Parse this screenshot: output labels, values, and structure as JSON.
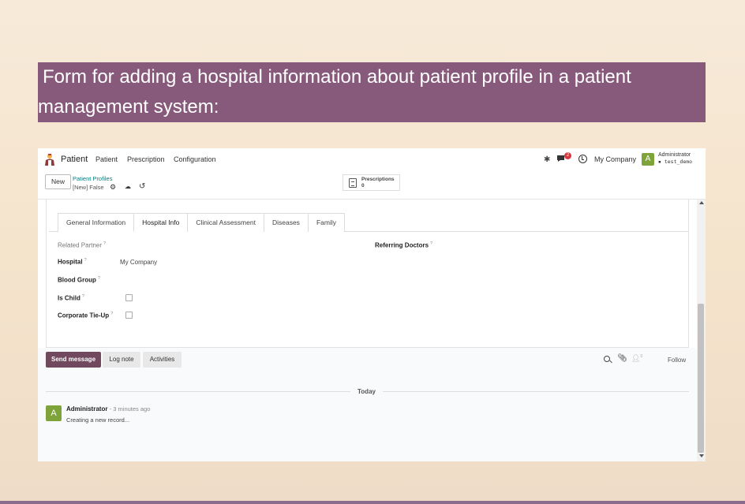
{
  "caption": {
    "line1": "Form for adding a hospital information about patient profile in a patient",
    "line2": "management system:"
  },
  "topnav": {
    "app_title": "Patient",
    "menu": [
      "Patient",
      "Prescription",
      "Configuration"
    ],
    "notification_count": "2",
    "company": "My Company",
    "user_initial": "A",
    "user_name": "Administrator",
    "database": "test_demo"
  },
  "control_panel": {
    "new_label": "New",
    "breadcrumb_parent": "Patient Profiles",
    "breadcrumb_current": "[New] False",
    "smart_button": {
      "label": "Prescriptions",
      "count": "0"
    }
  },
  "tabs": [
    "General Information",
    "Hospital Info",
    "Clinical Assessment",
    "Diseases",
    "Family"
  ],
  "active_tab": "Hospital Info",
  "form": {
    "related_partner_label": "Related Partner",
    "referring_doctors_label": "Referring Doctors",
    "hospital_label": "Hospital",
    "hospital_value": "My Company",
    "blood_group_label": "Blood Group",
    "is_child_label": "Is Child",
    "is_child_checked": false,
    "corporate_tieup_label": "Corporate Tie-Up",
    "corporate_tieup_checked": false,
    "help_mark": "?"
  },
  "chatter": {
    "send_message": "Send message",
    "log_note": "Log note",
    "activities": "Activities",
    "followers_count": "0",
    "follow": "Follow",
    "date_separator": "Today",
    "messages": [
      {
        "initial": "A",
        "author": "Administrator",
        "time": "- 3 minutes ago",
        "body": "Creating a new record..."
      }
    ]
  },
  "colors": {
    "banner": "#875a7b",
    "primary": "#71495f",
    "link": "#017e84",
    "avatar": "#7fa33b",
    "badge": "#d9363e"
  }
}
